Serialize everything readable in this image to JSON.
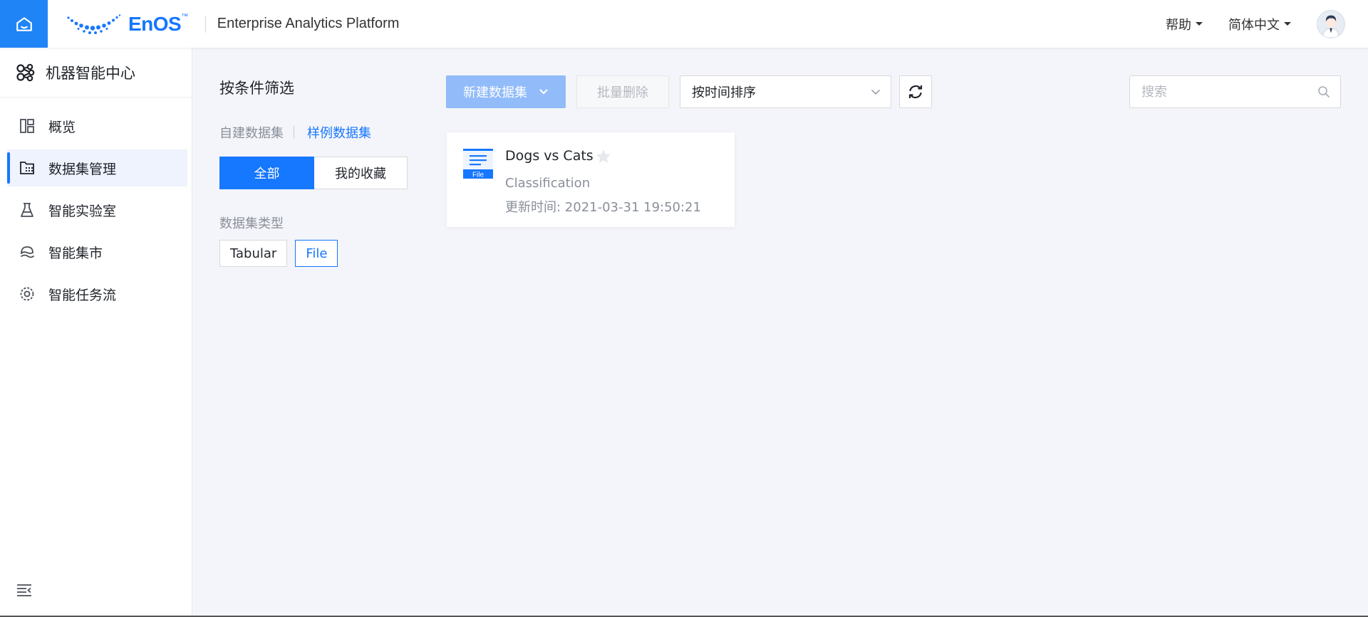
{
  "header": {
    "logo_text": "EnOS",
    "logo_tm": "™",
    "platform_name": "Enterprise Analytics Platform",
    "help_label": "帮助",
    "language_label": "简体中文"
  },
  "sidebar": {
    "title": "机器智能中心",
    "items": [
      {
        "label": "概览",
        "icon": "dashboard-icon"
      },
      {
        "label": "数据集管理",
        "icon": "dataset-icon",
        "active": true
      },
      {
        "label": "智能实验室",
        "icon": "flask-icon"
      },
      {
        "label": "智能集市",
        "icon": "market-icon"
      },
      {
        "label": "智能任务流",
        "icon": "workflow-icon"
      }
    ]
  },
  "filter": {
    "title": "按条件筛选",
    "tabs": [
      "自建数据集",
      "样例数据集"
    ],
    "active_tab": "样例数据集",
    "segments": [
      "全部",
      "我的收藏"
    ],
    "active_segment": "全部",
    "type_label": "数据集类型",
    "types": [
      "Tabular",
      "File"
    ],
    "selected_type": "File"
  },
  "toolbar": {
    "new_label": "新建数据集",
    "batch_delete_label": "批量删除",
    "sort_value": "按时间排序",
    "search_placeholder": "搜索"
  },
  "datasets": [
    {
      "name": "Dogs vs Cats",
      "icon_label": "File",
      "type": "Classification",
      "updated": "更新时间: 2021-03-31 19:50:21",
      "favorited": false
    }
  ],
  "colors": {
    "primary": "#1677ff",
    "home": "#1f84f6",
    "new_button_disabled": "#91bbf9",
    "background": "#f4f5fa"
  }
}
